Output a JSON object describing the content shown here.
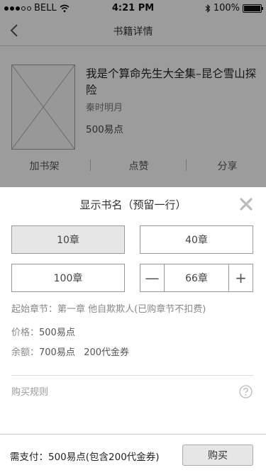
{
  "status_bar": {
    "carrier": "BELL",
    "time": "4:21 PM",
    "battery": "100%"
  },
  "nav": {
    "title": "书籍详情"
  },
  "book": {
    "title": "我是个算命先生大全集–昆仑雪山探险",
    "author": "秦时明月",
    "price": "500易点"
  },
  "actions": {
    "shelf": "加书架",
    "like": "点赞",
    "share": "分享"
  },
  "sheet": {
    "title": "显示书名（预留一行）",
    "options": {
      "opt1": "10章",
      "opt2": "40章",
      "opt3": "100章"
    },
    "stepper": {
      "minus": "—",
      "value": "66章",
      "plus": "+"
    },
    "start_label": "起始章节：",
    "start_value": "第一章 他自欺欺人(已购章节不扣费)",
    "price_label": "价格：",
    "price_value": "500易点",
    "balance_label": "余额：",
    "balance_value": "700易点   200代金券",
    "rules_label": "购买规则"
  },
  "bottom": {
    "pay_text": "需支付：500易点(包含200代金券)",
    "buy_label": "购买"
  }
}
